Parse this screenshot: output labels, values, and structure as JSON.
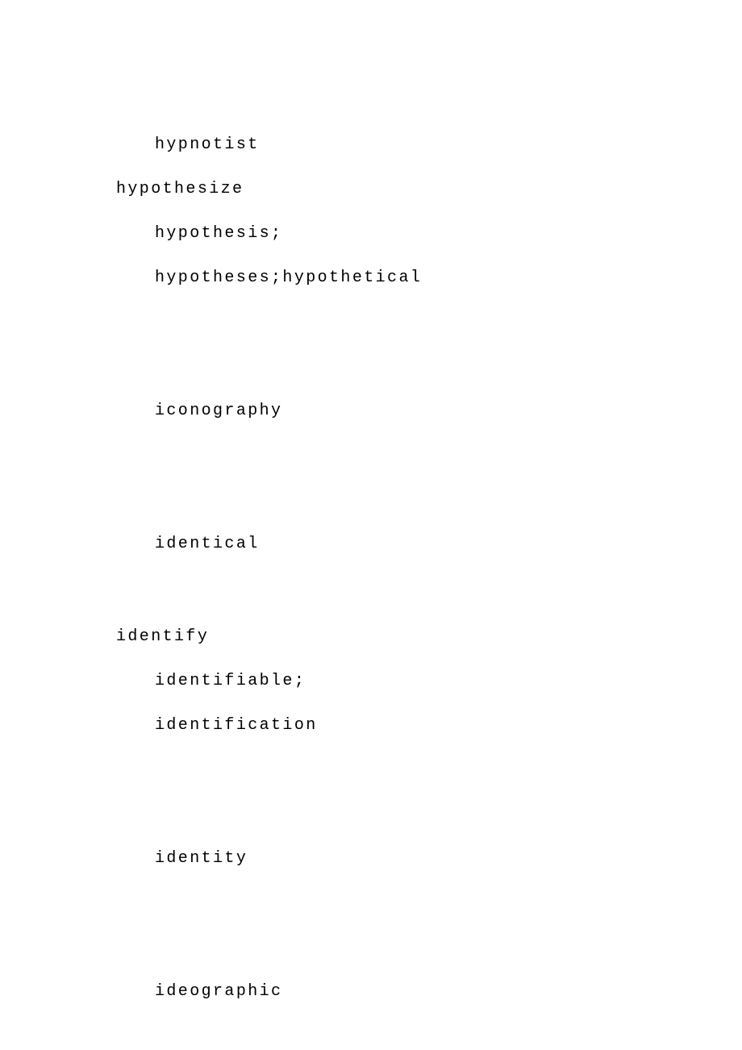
{
  "lines": [
    {
      "type": "sub",
      "text": "hypnotist"
    },
    {
      "type": "main",
      "text": "hypothesize"
    },
    {
      "type": "sub",
      "text": "hypothesis;"
    },
    {
      "type": "sub",
      "text": "hypotheses;hypothetical"
    },
    {
      "type": "spacer-large"
    },
    {
      "type": "sub",
      "text": "iconography"
    },
    {
      "type": "spacer-large"
    },
    {
      "type": "sub",
      "text": "identical"
    },
    {
      "type": "spacer-small"
    },
    {
      "type": "main",
      "text": "identify"
    },
    {
      "type": "sub",
      "text": "identifiable;"
    },
    {
      "type": "sub",
      "text": "identification"
    },
    {
      "type": "spacer-large"
    },
    {
      "type": "sub",
      "text": "identity"
    },
    {
      "type": "spacer-large"
    },
    {
      "type": "sub",
      "text": "ideographic"
    }
  ]
}
